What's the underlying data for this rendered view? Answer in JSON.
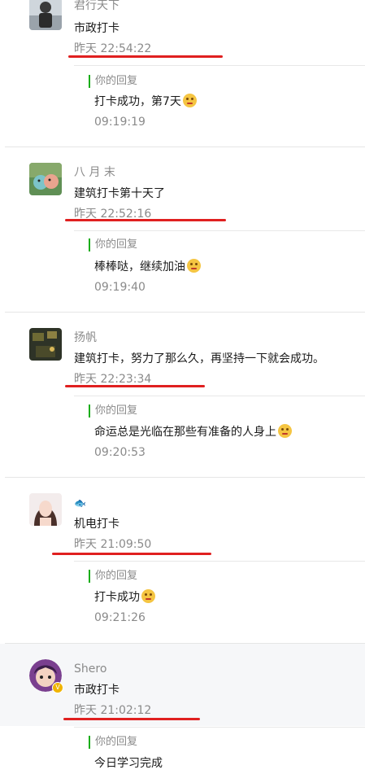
{
  "comments": [
    {
      "name": "君行天下",
      "content": "市政打卡",
      "time": "昨天 22:54:22",
      "reply_label": "你的回复",
      "reply_text": "打卡成功，第7天",
      "reply_time": "09:19:19"
    },
    {
      "name": "八 月 末",
      "content": "建筑打卡第十天了",
      "time": "昨天 22:52:16",
      "reply_label": "你的回复",
      "reply_text": "棒棒哒，继续加油",
      "reply_time": "09:19:40"
    },
    {
      "name": "扬帆",
      "content": "建筑打卡，努力了那么久，再坚持一下就会成功。",
      "time": "昨天 22:23:34",
      "reply_label": "你的回复",
      "reply_text": "命运总是光临在那些有准备的人身上",
      "reply_time": "09:20:53"
    },
    {
      "name": "🐟",
      "content": "机电打卡",
      "time": "昨天 21:09:50",
      "reply_label": "你的回复",
      "reply_text": "打卡成功",
      "reply_time": "09:21:26"
    },
    {
      "name": "Shero",
      "content": "市政打卡",
      "time": "昨天 21:02:12",
      "reply_label": "你的回复",
      "reply_text": "今日学习完成"
    }
  ],
  "colors": {
    "underline": "#e02020",
    "reply_bar": "#1aad19",
    "highlight_bg": "#f6f7f9"
  },
  "icons": {
    "reply_emoji": "smiling-emoji-icon",
    "verified_badge": "v-badge-icon"
  }
}
